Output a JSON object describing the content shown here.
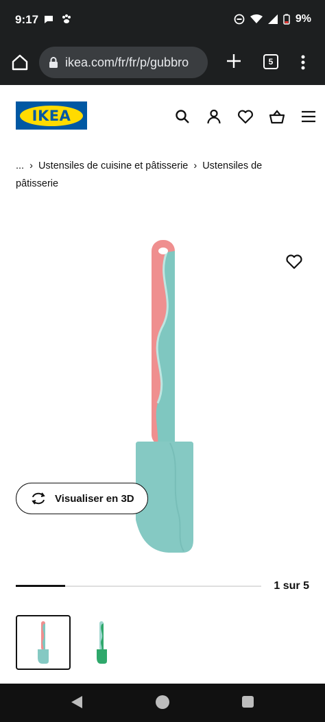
{
  "status_bar": {
    "time": "9:17",
    "battery": "9%",
    "icons": [
      "chat-icon",
      "paw-icon",
      "dnd-icon",
      "wifi-icon",
      "signal-icon",
      "battery-low-icon"
    ]
  },
  "browser": {
    "url": "ikea.com/fr/fr/p/gubbro",
    "tab_count": "5"
  },
  "header": {
    "logo_text": "IKEA",
    "icons": [
      "search-icon",
      "account-icon",
      "heart-icon",
      "basket-icon",
      "hamburger-icon"
    ]
  },
  "breadcrumb": {
    "ellipsis": "...",
    "item1": "Ustensiles de cuisine et pâtisserie",
    "item2": "Ustensiles de pâtisserie"
  },
  "product": {
    "view_3d_label": "Visualiser en 3D",
    "pager_text": "1 sur 5",
    "pager_fraction": 0.2,
    "colors": {
      "handle_pink": "#ef8f8f",
      "teal": "#7fc7c0",
      "thumb2_green": "#2fa86b"
    }
  },
  "colors": {
    "ikea_blue": "#0058a3",
    "ikea_yellow": "#ffdb00",
    "dark_bar": "#1d1f20"
  }
}
